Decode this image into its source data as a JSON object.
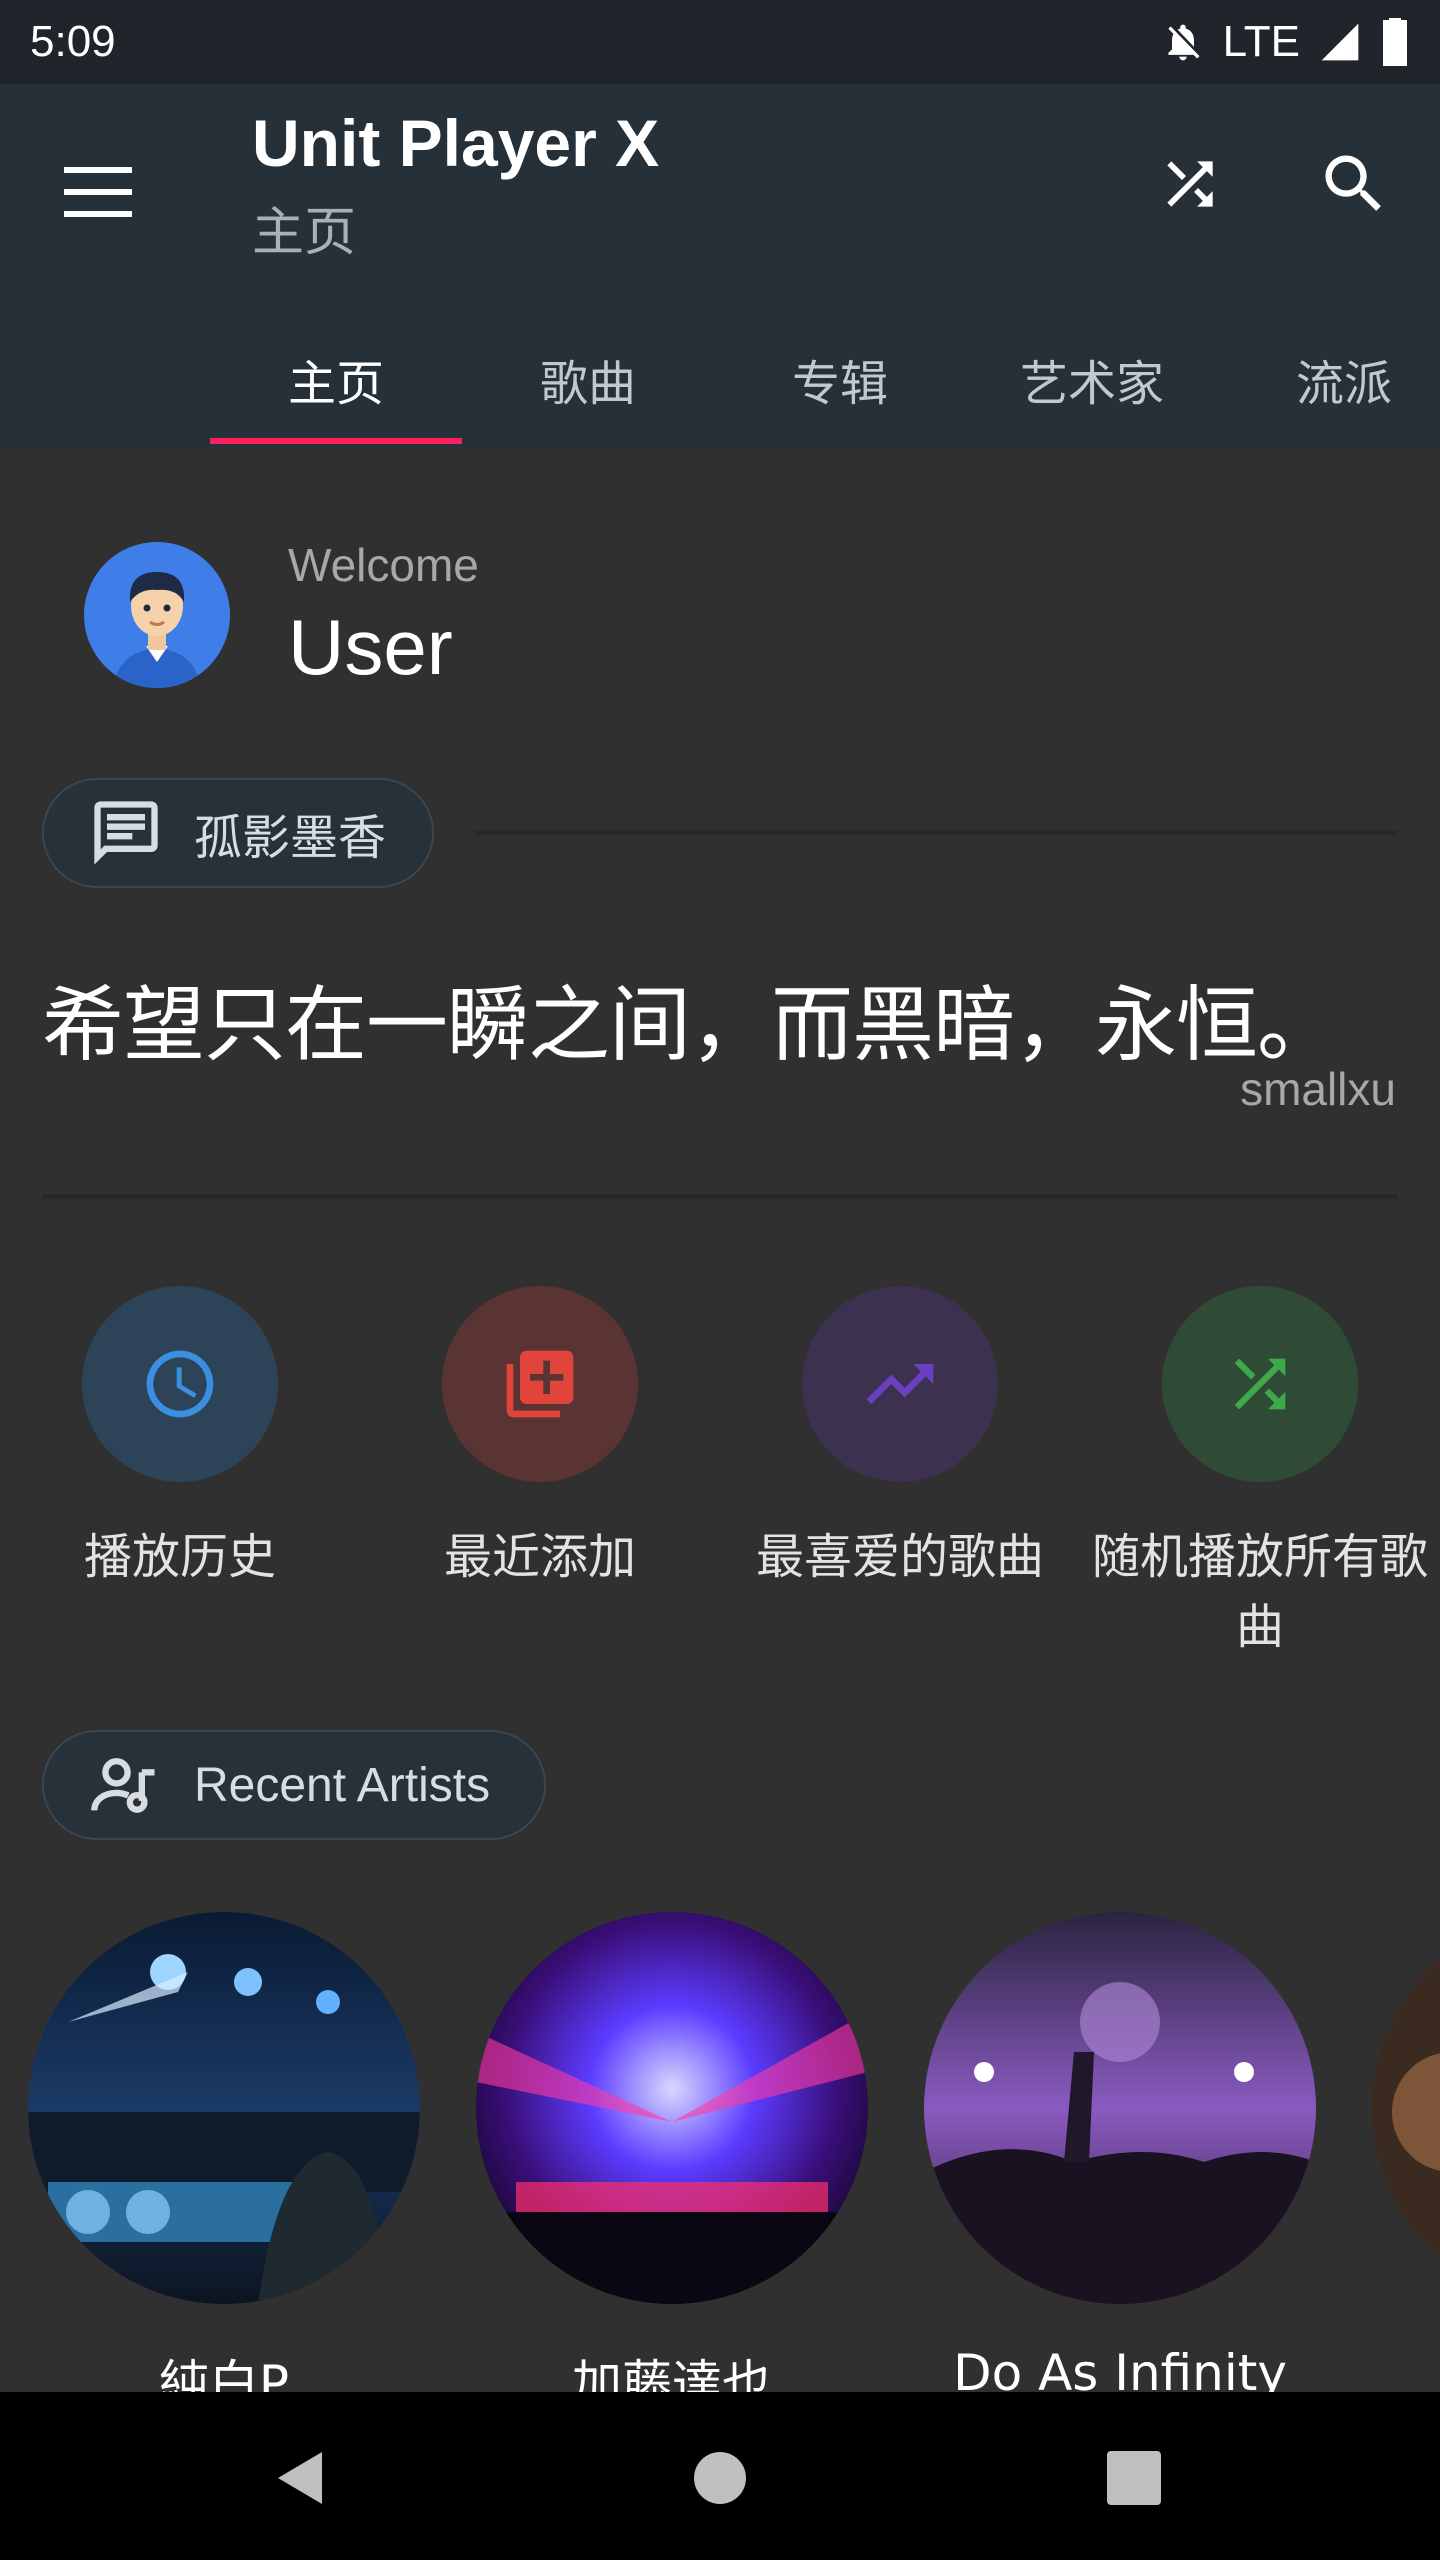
{
  "status_bar": {
    "time": "5:09",
    "network": "LTE"
  },
  "app_bar": {
    "title": "Unit Player X",
    "subtitle": "主页",
    "menu_icon": "menu-icon",
    "shuffle_icon": "shuffle-icon",
    "search_icon": "search-icon"
  },
  "tabs": [
    {
      "label": "主页",
      "active": true
    },
    {
      "label": "歌曲",
      "active": false
    },
    {
      "label": "专辑",
      "active": false
    },
    {
      "label": "艺术家",
      "active": false
    },
    {
      "label": "流派",
      "active": false
    }
  ],
  "accent_color": "#ff1f5a",
  "welcome": {
    "greeting": "Welcome",
    "name": "User"
  },
  "quote": {
    "chip_label": "孤影墨香",
    "text": "希望只在一瞬之间，而黑暗，永恒。",
    "author": "smallxu"
  },
  "shortcuts": [
    {
      "label": "播放历史",
      "icon": "history-clock-icon",
      "color": "#3a8fe0"
    },
    {
      "label": "最近添加",
      "icon": "library-add-icon",
      "color": "#e0443a"
    },
    {
      "label": "最喜爱的歌曲",
      "icon": "trending-up-icon",
      "color": "#6b3fc0"
    },
    {
      "label": "随机播放所有歌曲",
      "icon": "shuffle-icon",
      "color": "#3fa84a"
    }
  ],
  "recent_artists": {
    "chip_label": "Recent Artists",
    "artists": [
      {
        "name": "純白P"
      },
      {
        "name": "加藤達也"
      },
      {
        "name": "Do As Infinity"
      }
    ]
  },
  "nav": {
    "back": "back-icon",
    "home": "home-icon",
    "recents": "recents-icon"
  }
}
